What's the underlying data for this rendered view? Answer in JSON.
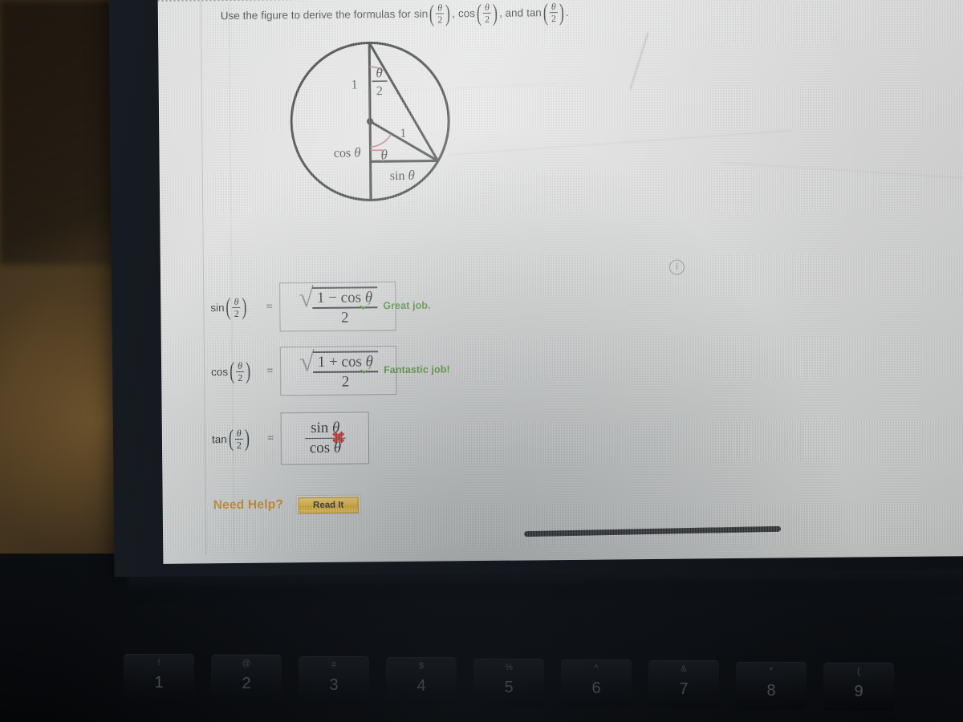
{
  "prompt": {
    "lead": "Use the figure to derive the formulas for",
    "fn1": "sin",
    "sep1": ",",
    "fn2": "cos",
    "sep2": ", and",
    "fn3": "tan",
    "end": ".",
    "arg_num": "θ",
    "arg_den": "2"
  },
  "figure": {
    "name": "unit-circle-half-angle-figure",
    "label_radius_top": "1",
    "label_half_angle_num": "θ",
    "label_half_angle_den": "2",
    "label_hypotenuse": "1",
    "label_center_angle": "θ",
    "label_cos": "cos θ",
    "label_sin": "sin θ",
    "right_angle_color": "#b4616f",
    "angle_arc_color": "#b4616f",
    "stroke_color": "#1a1d20"
  },
  "info_icon": {
    "glyph": "i"
  },
  "answers": [
    {
      "id": "sin",
      "fn": "sin",
      "arg_num": "θ",
      "arg_den": "2",
      "equals": "=",
      "has_radical": true,
      "numerator": "1 − cos  θ",
      "denominator": "2",
      "feedback_mark": "check",
      "feedback_text": "Great job.",
      "feedback_color": "#4e8f33"
    },
    {
      "id": "cos",
      "fn": "cos",
      "arg_num": "θ",
      "arg_den": "2",
      "equals": "=",
      "has_radical": true,
      "numerator": "1 + cos  θ",
      "denominator": "2",
      "feedback_mark": "check",
      "feedback_text": "Fantastic job!",
      "feedback_color": "#4e8f33"
    },
    {
      "id": "tan",
      "fn": "tan",
      "arg_num": "θ",
      "arg_den": "2",
      "equals": "=",
      "has_radical": false,
      "numerator": "sin  θ",
      "denominator": "cos  θ",
      "feedback_mark": "cross",
      "feedback_text": "",
      "feedback_color": "#cc2a2a"
    }
  ],
  "help": {
    "label": "Need Help?",
    "button_label": "Read It",
    "label_color": "#d08a16"
  },
  "keyboard": {
    "keys": [
      {
        "symbol": "!",
        "number": "1"
      },
      {
        "symbol": "@",
        "number": "2"
      },
      {
        "symbol": "#",
        "number": "3"
      },
      {
        "symbol": "$",
        "number": "4"
      },
      {
        "symbol": "%",
        "number": "5"
      },
      {
        "symbol": "^",
        "number": "6"
      },
      {
        "symbol": "&",
        "number": "7"
      },
      {
        "symbol": "*",
        "number": "8"
      },
      {
        "symbol": "(",
        "number": "9"
      }
    ]
  }
}
